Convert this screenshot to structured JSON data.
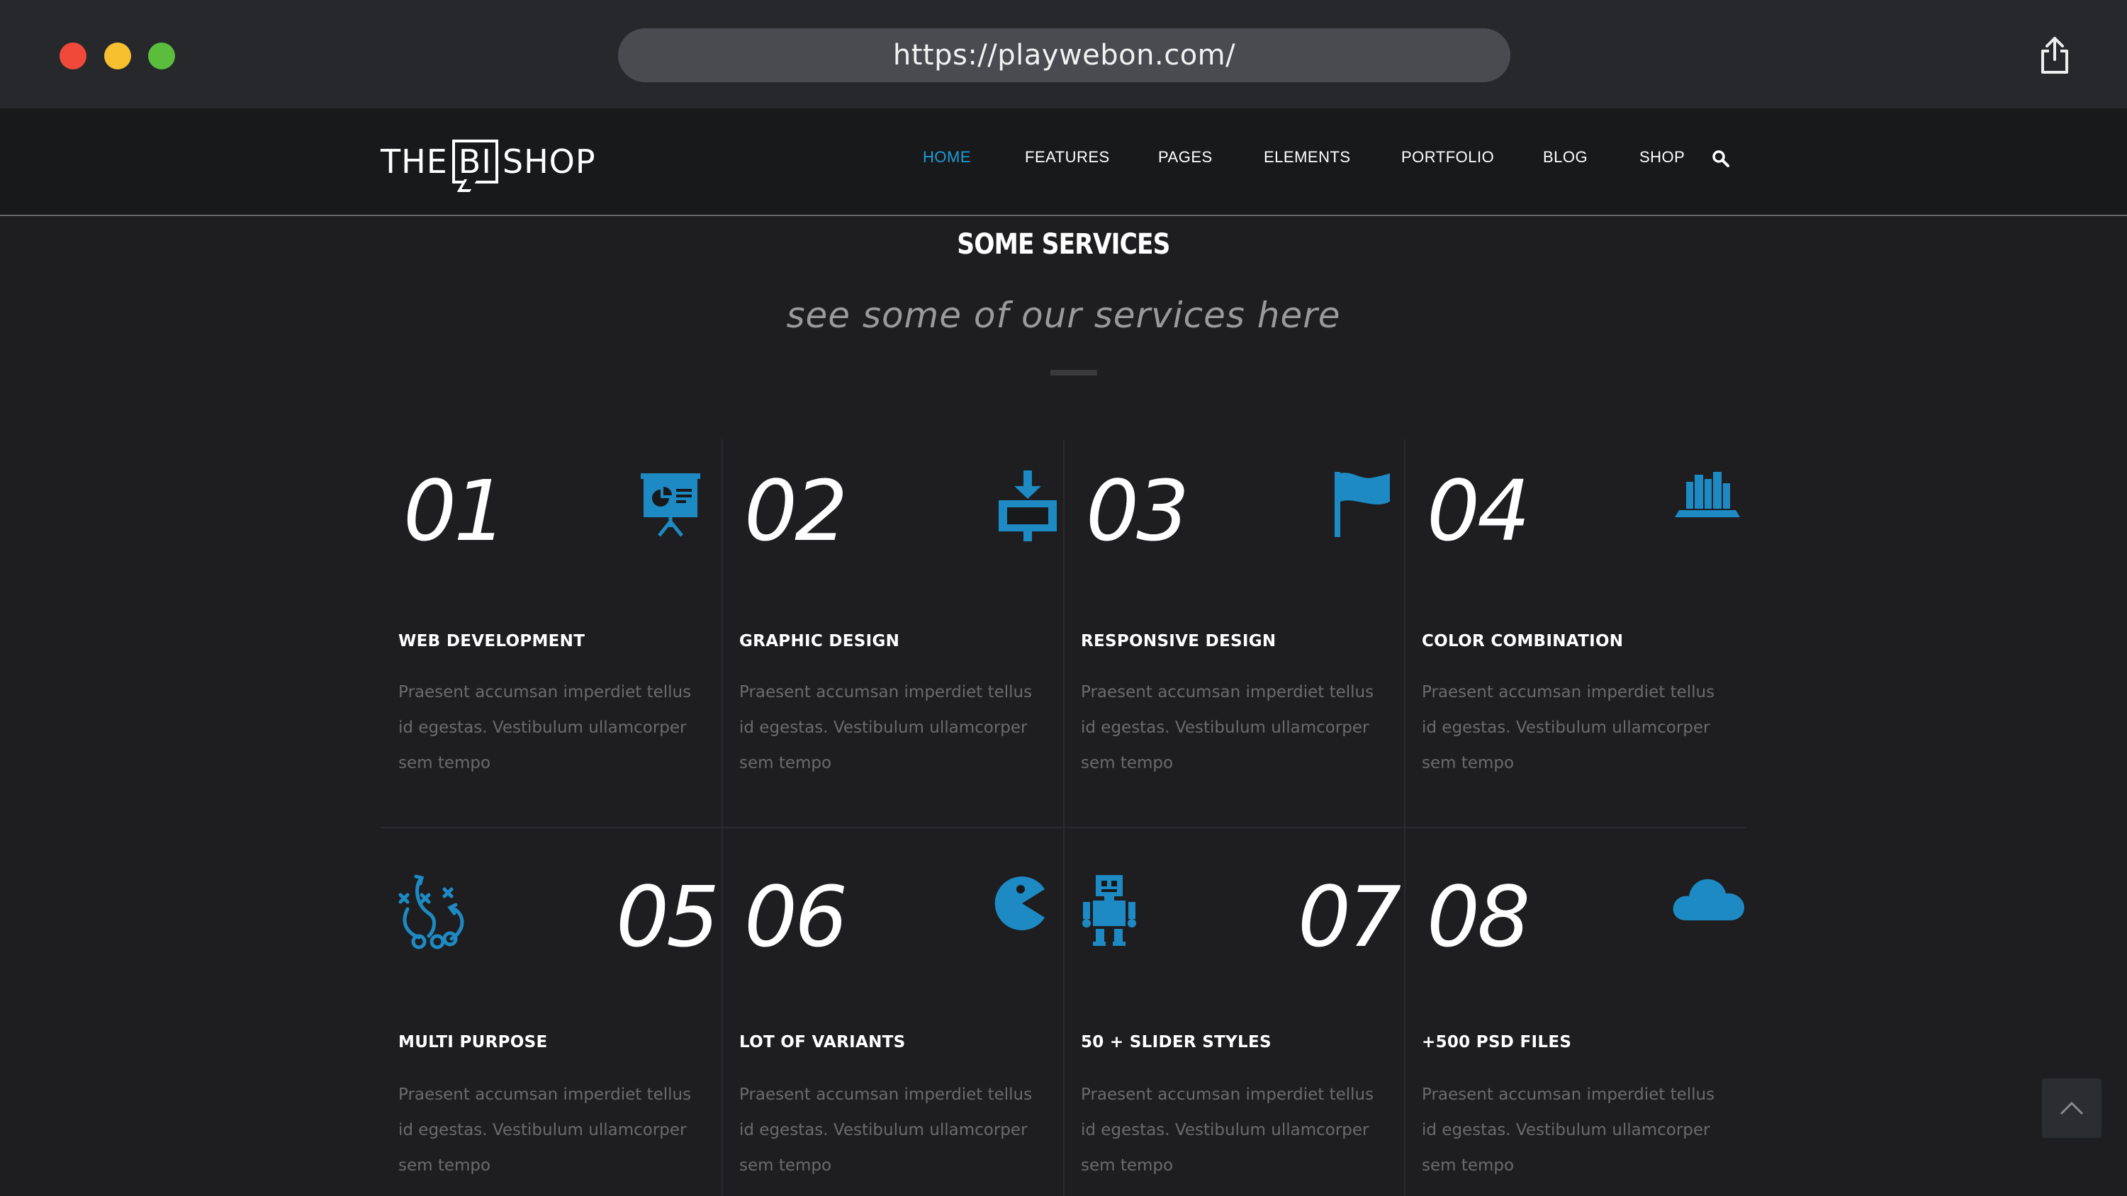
{
  "browser": {
    "url": "https://playwebon.com/"
  },
  "site": {
    "logo": {
      "left": "THE",
      "boxed": "BI",
      "right": "SHOP"
    },
    "nav": [
      "HOME",
      "FEATURES",
      "PAGES",
      "ELEMENTS",
      "PORTFOLIO",
      "BLOG",
      "SHOP"
    ],
    "active_nav": "HOME"
  },
  "section": {
    "title": "SOME SERVICES",
    "subtitle": "see some of our services here"
  },
  "services": [
    {
      "number": "01",
      "title": "WEB DEVELOPMENT",
      "desc": "Praesent accumsan imperdiet tellus id egestas. Vestibulum ullamcorper sem tempo",
      "icon": "presentation-icon"
    },
    {
      "number": "02",
      "title": "GRAPHIC DESIGN",
      "desc": "Praesent accumsan imperdiet tellus id egestas. Vestibulum ullamcorper sem tempo",
      "icon": "monitor-download-icon"
    },
    {
      "number": "03",
      "title": "RESPONSIVE DESIGN",
      "desc": "Praesent accumsan imperdiet tellus id egestas. Vestibulum ullamcorper sem tempo",
      "icon": "flag-icon"
    },
    {
      "number": "04",
      "title": "COLOR COMBINATION",
      "desc": "Praesent accumsan imperdiet tellus id egestas. Vestibulum ullamcorper sem tempo",
      "icon": "bookshelf-icon"
    },
    {
      "number": "05",
      "title": "MULTI PURPOSE",
      "desc": "Praesent accumsan imperdiet tellus id egestas. Vestibulum ullamcorper sem tempo",
      "icon": "strategy-icon"
    },
    {
      "number": "06",
      "title": "LOT OF VARIANTS",
      "desc": "Praesent accumsan imperdiet tellus id egestas. Vestibulum ullamcorper sem tempo",
      "icon": "pacman-icon"
    },
    {
      "number": "07",
      "title": "50 + SLIDER STYLES",
      "desc": "Praesent accumsan imperdiet tellus id egestas. Vestibulum ullamcorper sem tempo",
      "icon": "robot-icon"
    },
    {
      "number": "08",
      "title": "+500 PSD FILES",
      "desc": "Praesent accumsan imperdiet tellus id egestas. Vestibulum ullamcorper sem tempo",
      "icon": "cloud-icon"
    }
  ],
  "colors": {
    "accent": "#1d9bd8",
    "icon": "#1d8ac4",
    "background": "#1e1e20",
    "header": "#18191b"
  }
}
